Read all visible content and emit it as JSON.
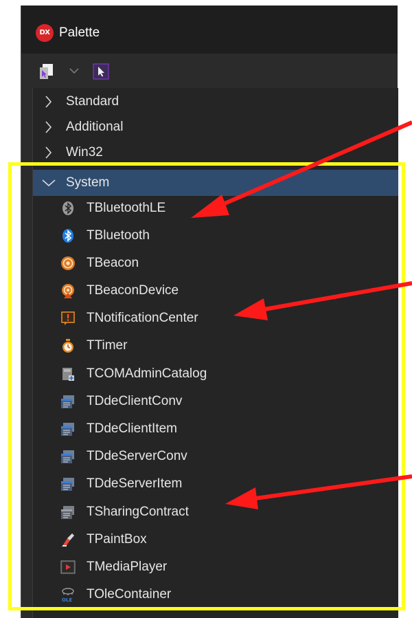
{
  "window": {
    "title": "Palette",
    "logo_text": "DX"
  },
  "toolbar": {
    "components_icon": "component-select-icon",
    "dropdown_icon": "chevron-down-icon",
    "pointer_icon": "pointer-arrow-icon"
  },
  "categories": [
    {
      "label": "Standard",
      "expanded": false
    },
    {
      "label": "Additional",
      "expanded": false
    },
    {
      "label": "Win32",
      "expanded": false
    },
    {
      "label": "System",
      "expanded": true
    }
  ],
  "system_components": [
    {
      "label": "TBluetoothLE",
      "icon": "bluetooth-le-icon"
    },
    {
      "label": "TBluetooth",
      "icon": "bluetooth-icon"
    },
    {
      "label": "TBeacon",
      "icon": "beacon-icon"
    },
    {
      "label": "TBeaconDevice",
      "icon": "beacon-device-icon"
    },
    {
      "label": "TNotificationCenter",
      "icon": "notification-icon"
    },
    {
      "label": "TTimer",
      "icon": "timer-icon"
    },
    {
      "label": "TCOMAdminCatalog",
      "icon": "com-admin-icon"
    },
    {
      "label": "TDdeClientConv",
      "icon": "dde-window-icon"
    },
    {
      "label": "TDdeClientItem",
      "icon": "dde-window-icon"
    },
    {
      "label": "TDdeServerConv",
      "icon": "dde-window-icon"
    },
    {
      "label": "TDdeServerItem",
      "icon": "dde-window-icon"
    },
    {
      "label": "TSharingContract",
      "icon": "sharing-contract-icon"
    },
    {
      "label": "TPaintBox",
      "icon": "paint-box-icon"
    },
    {
      "label": "TMediaPlayer",
      "icon": "media-player-icon"
    },
    {
      "label": "TOleContainer",
      "icon": "ole-container-icon"
    }
  ],
  "colors": {
    "highlight": "#ffff1a",
    "arrow": "#ff1a1a",
    "selection": "#2f4c6e",
    "panel": "#252526"
  }
}
